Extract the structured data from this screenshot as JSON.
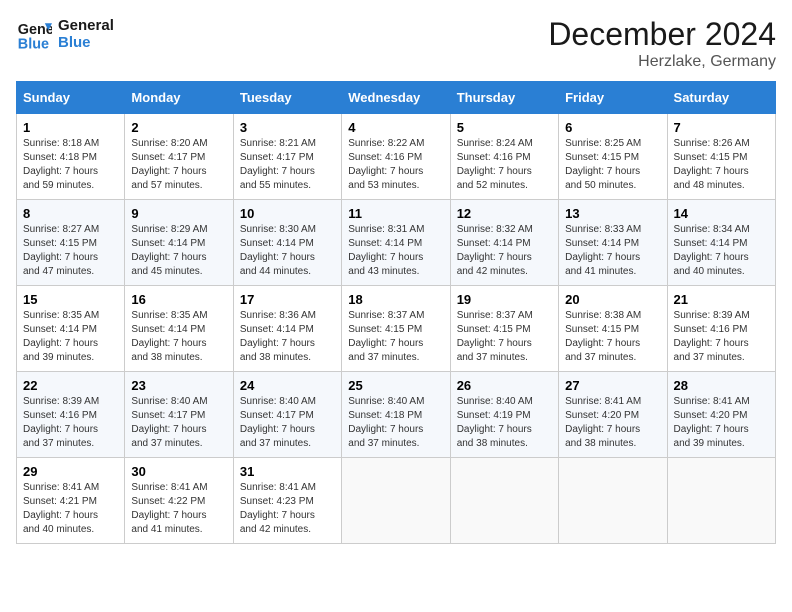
{
  "header": {
    "logo_line1": "General",
    "logo_line2": "Blue",
    "month": "December 2024",
    "location": "Herzlake, Germany"
  },
  "days_of_week": [
    "Sunday",
    "Monday",
    "Tuesday",
    "Wednesday",
    "Thursday",
    "Friday",
    "Saturday"
  ],
  "weeks": [
    [
      {
        "day": "1",
        "sunrise": "8:18 AM",
        "sunset": "4:18 PM",
        "daylight": "7 hours and 59 minutes."
      },
      {
        "day": "2",
        "sunrise": "8:20 AM",
        "sunset": "4:17 PM",
        "daylight": "7 hours and 57 minutes."
      },
      {
        "day": "3",
        "sunrise": "8:21 AM",
        "sunset": "4:17 PM",
        "daylight": "7 hours and 55 minutes."
      },
      {
        "day": "4",
        "sunrise": "8:22 AM",
        "sunset": "4:16 PM",
        "daylight": "7 hours and 53 minutes."
      },
      {
        "day": "5",
        "sunrise": "8:24 AM",
        "sunset": "4:16 PM",
        "daylight": "7 hours and 52 minutes."
      },
      {
        "day": "6",
        "sunrise": "8:25 AM",
        "sunset": "4:15 PM",
        "daylight": "7 hours and 50 minutes."
      },
      {
        "day": "7",
        "sunrise": "8:26 AM",
        "sunset": "4:15 PM",
        "daylight": "7 hours and 48 minutes."
      }
    ],
    [
      {
        "day": "8",
        "sunrise": "8:27 AM",
        "sunset": "4:15 PM",
        "daylight": "7 hours and 47 minutes."
      },
      {
        "day": "9",
        "sunrise": "8:29 AM",
        "sunset": "4:14 PM",
        "daylight": "7 hours and 45 minutes."
      },
      {
        "day": "10",
        "sunrise": "8:30 AM",
        "sunset": "4:14 PM",
        "daylight": "7 hours and 44 minutes."
      },
      {
        "day": "11",
        "sunrise": "8:31 AM",
        "sunset": "4:14 PM",
        "daylight": "7 hours and 43 minutes."
      },
      {
        "day": "12",
        "sunrise": "8:32 AM",
        "sunset": "4:14 PM",
        "daylight": "7 hours and 42 minutes."
      },
      {
        "day": "13",
        "sunrise": "8:33 AM",
        "sunset": "4:14 PM",
        "daylight": "7 hours and 41 minutes."
      },
      {
        "day": "14",
        "sunrise": "8:34 AM",
        "sunset": "4:14 PM",
        "daylight": "7 hours and 40 minutes."
      }
    ],
    [
      {
        "day": "15",
        "sunrise": "8:35 AM",
        "sunset": "4:14 PM",
        "daylight": "7 hours and 39 minutes."
      },
      {
        "day": "16",
        "sunrise": "8:35 AM",
        "sunset": "4:14 PM",
        "daylight": "7 hours and 38 minutes."
      },
      {
        "day": "17",
        "sunrise": "8:36 AM",
        "sunset": "4:14 PM",
        "daylight": "7 hours and 38 minutes."
      },
      {
        "day": "18",
        "sunrise": "8:37 AM",
        "sunset": "4:15 PM",
        "daylight": "7 hours and 37 minutes."
      },
      {
        "day": "19",
        "sunrise": "8:37 AM",
        "sunset": "4:15 PM",
        "daylight": "7 hours and 37 minutes."
      },
      {
        "day": "20",
        "sunrise": "8:38 AM",
        "sunset": "4:15 PM",
        "daylight": "7 hours and 37 minutes."
      },
      {
        "day": "21",
        "sunrise": "8:39 AM",
        "sunset": "4:16 PM",
        "daylight": "7 hours and 37 minutes."
      }
    ],
    [
      {
        "day": "22",
        "sunrise": "8:39 AM",
        "sunset": "4:16 PM",
        "daylight": "7 hours and 37 minutes."
      },
      {
        "day": "23",
        "sunrise": "8:40 AM",
        "sunset": "4:17 PM",
        "daylight": "7 hours and 37 minutes."
      },
      {
        "day": "24",
        "sunrise": "8:40 AM",
        "sunset": "4:17 PM",
        "daylight": "7 hours and 37 minutes."
      },
      {
        "day": "25",
        "sunrise": "8:40 AM",
        "sunset": "4:18 PM",
        "daylight": "7 hours and 37 minutes."
      },
      {
        "day": "26",
        "sunrise": "8:40 AM",
        "sunset": "4:19 PM",
        "daylight": "7 hours and 38 minutes."
      },
      {
        "day": "27",
        "sunrise": "8:41 AM",
        "sunset": "4:20 PM",
        "daylight": "7 hours and 38 minutes."
      },
      {
        "day": "28",
        "sunrise": "8:41 AM",
        "sunset": "4:20 PM",
        "daylight": "7 hours and 39 minutes."
      }
    ],
    [
      {
        "day": "29",
        "sunrise": "8:41 AM",
        "sunset": "4:21 PM",
        "daylight": "7 hours and 40 minutes."
      },
      {
        "day": "30",
        "sunrise": "8:41 AM",
        "sunset": "4:22 PM",
        "daylight": "7 hours and 41 minutes."
      },
      {
        "day": "31",
        "sunrise": "8:41 AM",
        "sunset": "4:23 PM",
        "daylight": "7 hours and 42 minutes."
      },
      null,
      null,
      null,
      null
    ]
  ],
  "labels": {
    "sunrise": "Sunrise:",
    "sunset": "Sunset:",
    "daylight": "Daylight:"
  }
}
